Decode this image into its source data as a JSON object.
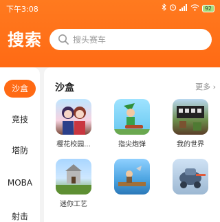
{
  "status_bar": {
    "time": "下午3:08",
    "battery": "92",
    "icons": [
      "bluetooth-icon",
      "alarm-icon",
      "signal-icon",
      "wifi-icon",
      "battery-icon"
    ]
  },
  "header": {
    "title": "搜索",
    "search": {
      "placeholder": "搜头赛车",
      "value": ""
    },
    "accent_color": "#ff6a14"
  },
  "sidebar": {
    "items": [
      {
        "label": "沙盒",
        "active": true
      },
      {
        "label": "竞技",
        "active": false
      },
      {
        "label": "塔防",
        "active": false
      },
      {
        "label": "MOBA",
        "active": false
      },
      {
        "label": "射击",
        "active": false
      }
    ]
  },
  "main": {
    "section_title": "沙盒",
    "more_label": "更多",
    "games": [
      {
        "name": "樱花校园...",
        "icon": "sakura-school-icon"
      },
      {
        "name": "指尖炮弹",
        "icon": "finger-cannon-icon"
      },
      {
        "name": "我的世界",
        "icon": "minecraft-icon"
      },
      {
        "name": "迷你工艺",
        "icon": "mini-craft-icon"
      },
      {
        "name": "",
        "icon": "raft-game-icon"
      },
      {
        "name": "",
        "icon": "robot-game-icon"
      }
    ]
  }
}
